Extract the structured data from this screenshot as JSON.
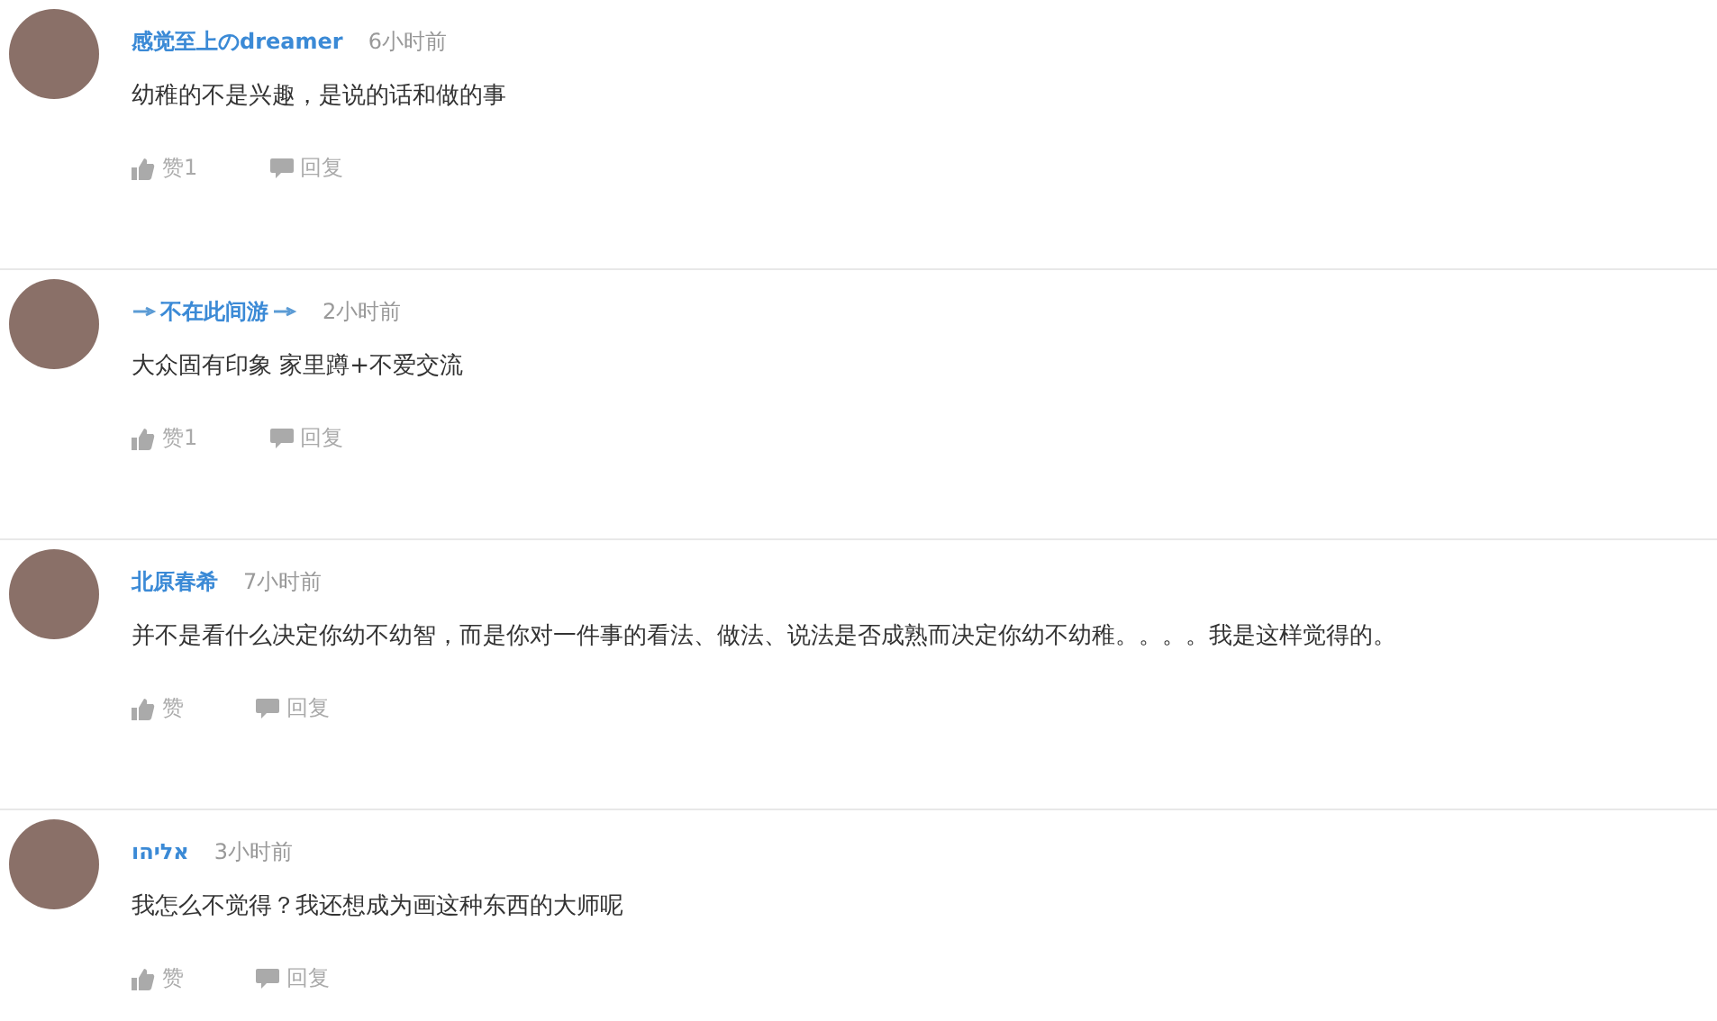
{
  "comments": [
    {
      "user": "感觉至上のdreamer",
      "decorated": false,
      "time": "6小时前",
      "text": "幼稚的不是兴趣，是说的话和做的事",
      "like": "赞1",
      "reply": "回复"
    },
    {
      "user": "不在此间游",
      "decorated": true,
      "time": "2小时前",
      "text": "大众固有印象 家里蹲+不爱交流",
      "like": "赞1",
      "reply": "回复"
    },
    {
      "user": "北原春希",
      "decorated": false,
      "time": "7小时前",
      "text": "并不是看什么决定你幼不幼智，而是你对一件事的看法、做法、说法是否成熟而决定你幼不幼稚。。。。我是这样觉得的。",
      "like": "赞",
      "reply": "回复"
    },
    {
      "user": "אליהו",
      "decorated": false,
      "time": "3小时前",
      "text": "我怎么不觉得？我还想成为画这种东西的大师呢",
      "like": "赞",
      "reply": "回复"
    }
  ]
}
